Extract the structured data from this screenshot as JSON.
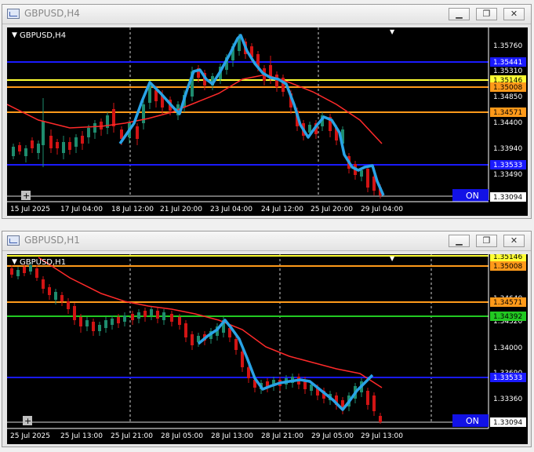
{
  "windows": [
    {
      "title": "GBPUSD,H4",
      "chart_label": "GBPUSD,H4",
      "on_label": "ON",
      "price_labels": [
        "1.35760",
        "1.35310",
        "1.34850",
        "1.34400",
        "1.33940",
        "1.33490"
      ],
      "tag_labels": [
        "1.35441",
        "1.35146",
        "1.35008",
        "1.34571",
        "1.33533",
        "1.33094"
      ],
      "time_labels": [
        "15 Jul 2025",
        "17 Jul 04:00",
        "18 Jul 12:00",
        "21 Jul 20:00",
        "23 Jul 04:00",
        "24 Jul 12:00",
        "25 Jul 20:00",
        "29 Jul 04:00"
      ]
    },
    {
      "title": "GBPUSD,H1",
      "chart_label": "GBPUSD,H1",
      "on_label": "ON",
      "price_labels": [
        "1.34640",
        "1.34320",
        "1.34000",
        "1.33690",
        "1.33360"
      ],
      "tag_labels": [
        "1.35146",
        "1.35008",
        "1.34571",
        "1.34392",
        "1.33533",
        "1.33094"
      ],
      "time_labels": [
        "25 Jul 2025",
        "25 Jul 13:00",
        "25 Jul 21:00",
        "28 Jul 05:00",
        "28 Jul 13:00",
        "28 Jul 21:00",
        "29 Jul 05:00",
        "29 Jul 13:00"
      ]
    }
  ],
  "colors": {
    "background": "#000000",
    "bull_candle": "#1e8c6e",
    "bear_candle": "#d21414",
    "moving_average": "#ff2a2a",
    "zigzag": "#29a3e6",
    "blue_line": "#1a1aff",
    "yellow_line": "#ffff33",
    "orange_line": "#ff9a1a",
    "green_line": "#22c922"
  }
}
